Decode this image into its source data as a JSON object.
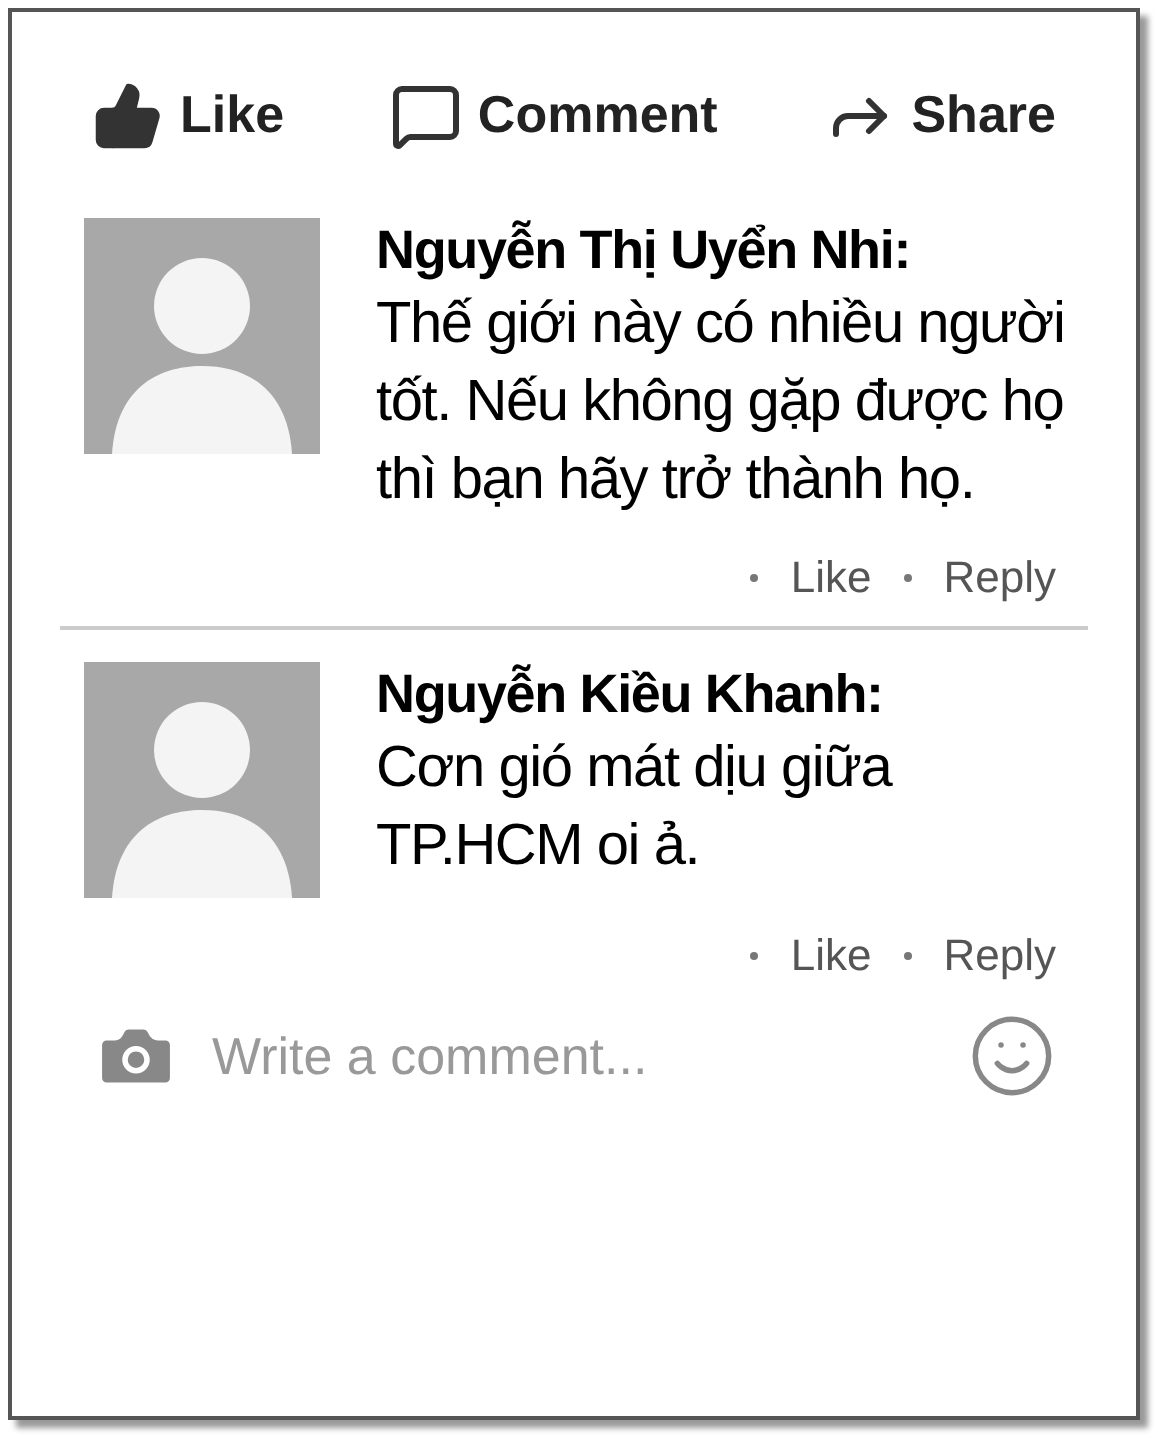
{
  "actions": [
    {
      "kind": "like",
      "label": "Like"
    },
    {
      "kind": "comment",
      "label": "Comment"
    },
    {
      "kind": "share",
      "label": "Share"
    }
  ],
  "comments": [
    {
      "author": "Nguyễn Thị Uyển Nhi:",
      "text": "Thế giới này có nhiều người tốt. Nếu không gặp được họ thì bạn hãy trở thành họ.",
      "links": [
        "Like",
        "Reply"
      ]
    },
    {
      "author": "Nguyễn Kiều Khanh:",
      "text": "Cơn gió mát dịu giữa TP.HCM oi ả.",
      "links": [
        "Like",
        "Reply"
      ]
    }
  ],
  "composer": {
    "placeholder": "Write a comment..."
  }
}
